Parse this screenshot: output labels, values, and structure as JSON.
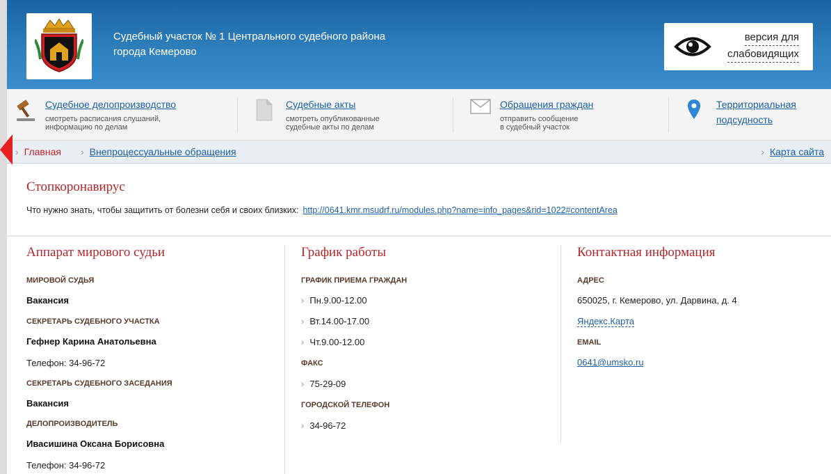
{
  "header": {
    "title_line1": "Судебный участок № 1 Центрального судебного района",
    "title_line2": "города Кемерово",
    "vision_line1": "версия для",
    "vision_line2": "слабовидящих"
  },
  "nav": [
    {
      "title": "Судебное делопроизводство",
      "sub1": "смотреть расписания слушаний,",
      "sub2": "информацию по делам",
      "icon": "gavel-icon"
    },
    {
      "title": "Судебные акты",
      "sub1": "смотреть опубликованные",
      "sub2": "судебные акты по делам",
      "icon": "document-icon"
    },
    {
      "title": "Обращения граждан",
      "sub1": "отправить сообщение",
      "sub2": "в судебный участок",
      "icon": "envelope-icon"
    },
    {
      "title_line1": "Территориальная",
      "title_line2": "подсудность",
      "icon": "map-pin-icon"
    }
  ],
  "breadcrumb": {
    "home": "Главная",
    "current": "Внепроцессуальные обращения",
    "sitemap": "Карта сайта"
  },
  "notice": {
    "title": "Стопкоронавирус",
    "text": "Что нужно знать, чтобы защитить от болезни себя и своих близких:",
    "link": "http://0641.kmr.msudrf.ru/modules.php?name=info_pages&rid=1022#contentArea"
  },
  "staff": {
    "title": "Аппарат мирового судьи",
    "judge_label": "МИРОВОЙ СУДЬЯ",
    "judge_value": "Вакансия",
    "secretary_label": "СЕКРЕТАРЬ СУДЕБНОГО УЧАСТКА",
    "secretary_value": "Гефнер Карина Анатольевна",
    "secretary_phone": "Телефон:  34-96-72",
    "session_label": "СЕКРЕТАРЬ СУДЕБНОГО ЗАСЕДАНИЯ",
    "session_value": "Вакансия",
    "clerk_label": "ДЕЛОПРОИЗВОДИТЕЛЬ",
    "clerk_value": "Ивасишина Оксана Борисовна",
    "clerk_phone": "Телефон:  34-96-72"
  },
  "schedule": {
    "title": "График работы",
    "reception_label": "ГРАФИК ПРИЕМА ГРАЖДАН",
    "reception": [
      "Пн.9.00-12.00",
      "Вт.14.00-17.00",
      "Чт.9.00-12.00"
    ],
    "fax_label": "ФАКС",
    "fax": "75-29-09",
    "phone_label": "ГОРОДСКОЙ ТЕЛЕФОН",
    "phone": "34-96-72"
  },
  "contacts": {
    "title": "Контактная информация",
    "address_label": "АДРЕС",
    "address": "650025, г. Кемерово, ул. Дарвина, д. 4",
    "map_link": "Яндекс.Карта",
    "email_label": "EMAIL",
    "email": "0641@umsko.ru"
  },
  "colors": {
    "header_blue": "#2f7fbd",
    "accent_red": "#b5262b",
    "link_blue": "#1f5fa6"
  }
}
